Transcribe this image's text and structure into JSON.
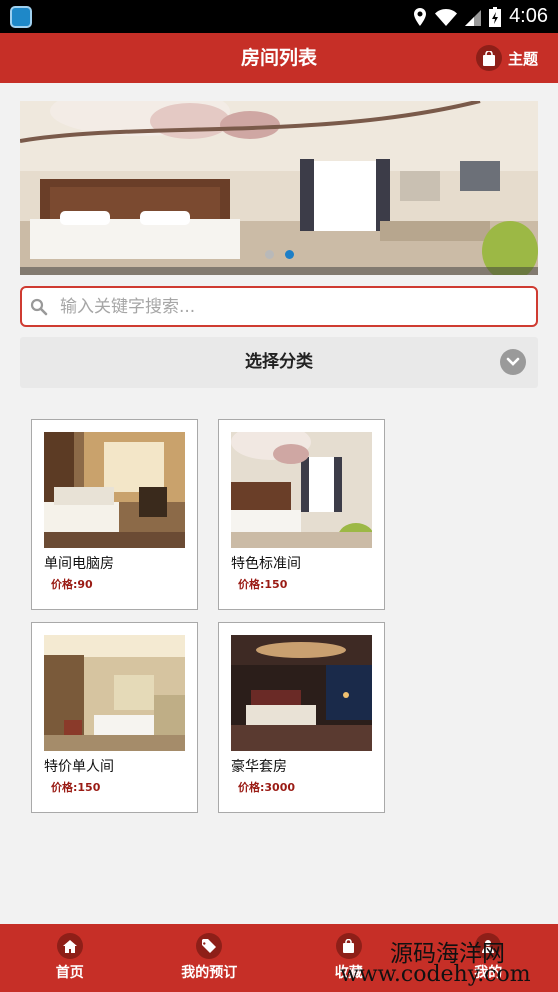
{
  "status_bar": {
    "time": "4:06"
  },
  "header": {
    "title": "房间列表",
    "theme_label": "主题"
  },
  "banner": {
    "active_slide": 2,
    "slide_count": 2
  },
  "search": {
    "placeholder": "输入关键字搜索..."
  },
  "category": {
    "label": "选择分类"
  },
  "rooms": [
    {
      "name": "单间电脑房",
      "price": "价格:90"
    },
    {
      "name": "特色标准间",
      "price": "价格:150"
    },
    {
      "name": "特价单人间",
      "price": "价格:150"
    },
    {
      "name": "豪华套房",
      "price": "价格:3000"
    }
  ],
  "bottom_nav": [
    {
      "label": "首页",
      "icon": "home-icon"
    },
    {
      "label": "我的预订",
      "icon": "tag-icon"
    },
    {
      "label": "收藏",
      "icon": "bag-icon"
    },
    {
      "label": "我的",
      "icon": "user-icon"
    }
  ],
  "watermark": {
    "line1": "源码海洋网",
    "line2": "www.codehy.com"
  },
  "colors": {
    "accent": "#c62f27",
    "accent_dark": "#8e1f18",
    "price": "#9a1b14",
    "dot_active": "#1d7fc7"
  }
}
